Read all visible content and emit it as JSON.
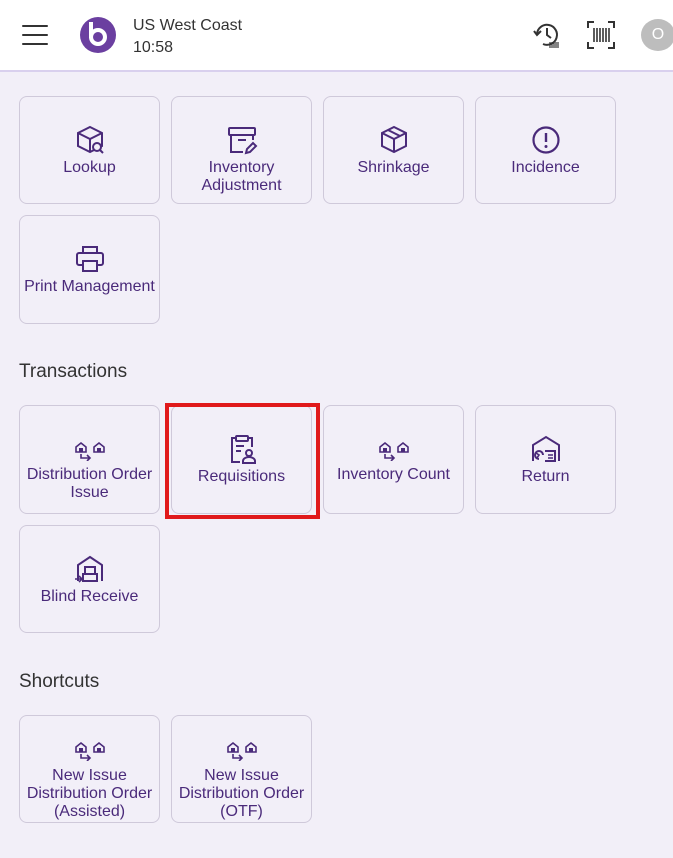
{
  "header": {
    "location": "US West Coast",
    "time": "10:58",
    "avatar_initial": "O",
    "icons": [
      "menu-icon",
      "logo-icon",
      "history-icon",
      "barcode-scan-icon"
    ]
  },
  "tiles_top": [
    {
      "label": "Lookup",
      "icon": "box-search-icon"
    },
    {
      "label": "Inventory Adjustment",
      "icon": "archive-edit-icon"
    },
    {
      "label": "Shrinkage",
      "icon": "box-icon"
    },
    {
      "label": "Incidence",
      "icon": "alert-circle-icon"
    },
    {
      "label": "Print Management",
      "icon": "printer-icon"
    }
  ],
  "transactions": {
    "title": "Transactions",
    "tiles": [
      {
        "label": "Distribution Order Issue",
        "icon": "warehouse-transfer-icon"
      },
      {
        "label": "Requisitions",
        "icon": "clipboard-user-icon"
      },
      {
        "label": "Inventory Count",
        "icon": "warehouse-transfer-icon"
      },
      {
        "label": "Return",
        "icon": "warehouse-return-icon"
      },
      {
        "label": "Blind Receive",
        "icon": "warehouse-receive-icon"
      }
    ]
  },
  "shortcuts": {
    "title": "Shortcuts",
    "tiles": [
      {
        "label": "New Issue Distribution Order (Assisted)",
        "icon": "warehouse-transfer-icon"
      },
      {
        "label": "New Issue Distribution Order (OTF)",
        "icon": "warehouse-transfer-icon"
      }
    ]
  },
  "colors": {
    "accent": "#4a2a7a",
    "highlight": "#e0191b",
    "background": "#f2eff8"
  }
}
